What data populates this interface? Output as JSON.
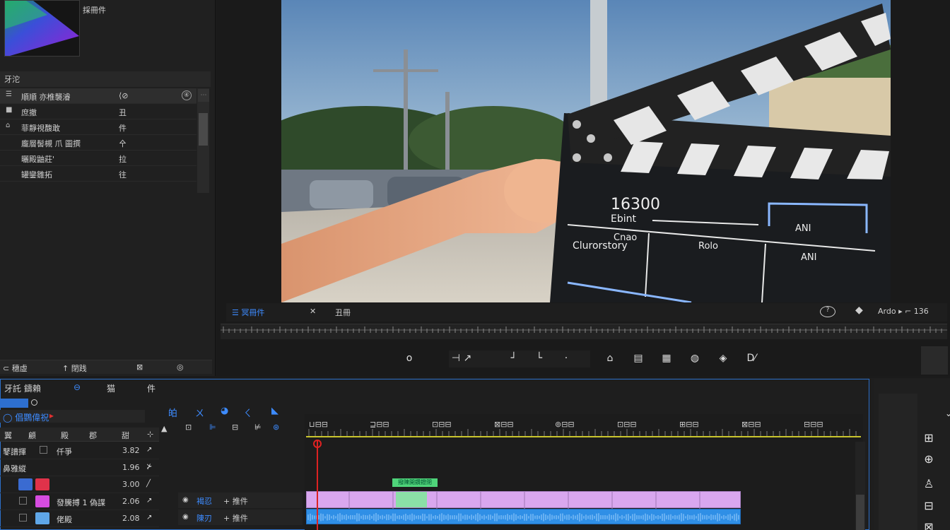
{
  "top_left": {
    "thumb_title": "採冊件"
  },
  "effects": {
    "header": "牙沱",
    "rows": [
      {
        "name": "順順 亦椎襲濬",
        "value": "⟨⊘",
        "key": "④"
      },
      {
        "name": "庶撤",
        "value": "丑"
      },
      {
        "name": "菲靜視馥敢",
        "value": "件"
      },
      {
        "name": "龐層髻槻 爪 圖撰",
        "value": "㐃"
      },
      {
        "name": "曬殿鼬莊'",
        "value": "拉"
      },
      {
        "name": "罐鑾雛拓",
        "value": "往"
      }
    ],
    "footer": [
      "⊂ 穗虛",
      "↑ 閉践",
      "⊠",
      "◎"
    ]
  },
  "monitor": {
    "tab_active": "☰ 冥冊件",
    "tab_second": "✕",
    "tab_third": "丑冊",
    "right_info": "Ardo ▸ ⌐ 136",
    "controls": [
      "o",
      "⊣ ↗",
      "┘",
      "└",
      "·",
      "⌂",
      "▤",
      "▦",
      "◍",
      "◈",
      "D⁄"
    ]
  },
  "clapperboard": {
    "line1": "16300",
    "line2": "Ebint",
    "line3": "Cnao",
    "line4": "Clurorstory",
    "line5": "Rolo",
    "line6": "ANI",
    "line7": "ANI"
  },
  "timeline": {
    "tabs": [
      "牙託",
      "鑄賴",
      "⊖",
      "猫",
      "件"
    ],
    "timecode": "◯ 倡鸚偉祝",
    "timecode_flag": "▸",
    "project_cols": [
      "翼",
      "顧",
      "殿",
      "郡",
      "甜",
      "⊹"
    ],
    "project_rows": [
      {
        "name": "仟爭",
        "left": "鼕譜揮",
        "duration": "3.82",
        "tool": "↗"
      },
      {
        "name": "",
        "left": "鼻雅縱",
        "duration": "1.96",
        "tool": "⊁"
      },
      {
        "name": "",
        "left": "",
        "duration": "3.00",
        "tool": "╱"
      },
      {
        "name": "發騰搏 1 偽諜",
        "left": "",
        "duration": "2.06",
        "tool": "↗"
      },
      {
        "name": "佬殿",
        "left": "",
        "duration": "2.08",
        "tool": "↗"
      }
    ],
    "tools_row1": [
      "㿟",
      "ㄨ",
      "◕",
      "ㄑ",
      "◣"
    ],
    "tools_row2": [
      "▲",
      "⊡",
      "⊫",
      "⊟",
      "⊭",
      "⊛"
    ],
    "ruler_labels": [
      "⊔⊟⊟",
      "⊒⊟⊟",
      "⊡⊟⊟",
      "⊠⊟⊟",
      "⊚⊟⊟",
      "⊡⊟⊟",
      "⊞⊟⊟",
      "⊠⊟⊟",
      "⊟⊟⊟"
    ],
    "track_heads": [
      {
        "name": "褐忍",
        "add": "+ 推件"
      },
      {
        "name": "陳刃",
        "add": "+ 推件"
      }
    ],
    "green_marker": "撥陳開鑽鐙閉"
  },
  "colors": {
    "accent": "#2c6fc9",
    "clip_video": "#d9a7ef",
    "clip_audio": "#2f8fe6",
    "playhead": "#dd2222"
  }
}
